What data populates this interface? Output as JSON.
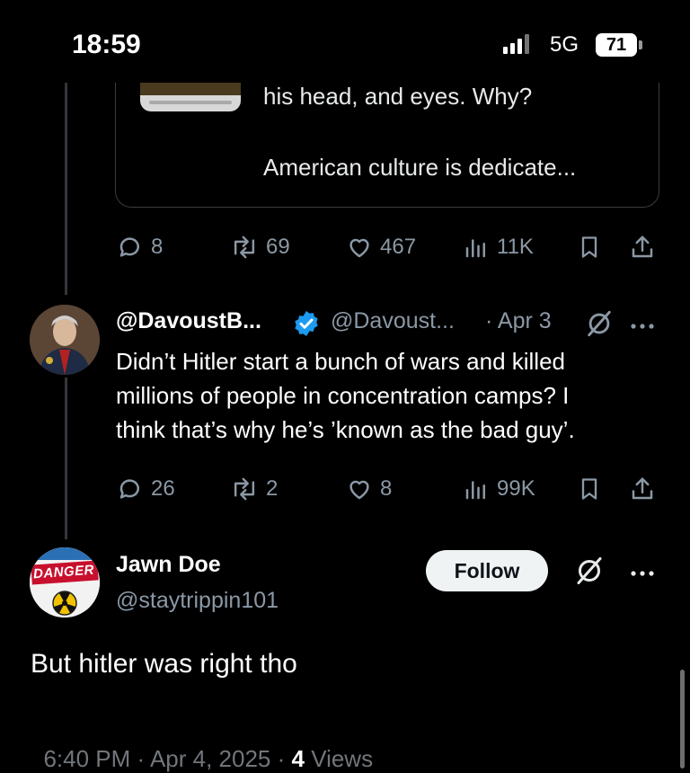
{
  "status_bar": {
    "time": "18:59",
    "network": "5G",
    "battery": "71"
  },
  "quoted_tweet": {
    "line1": "his head, and eyes.  Why?",
    "line2": "American culture is dedicate..."
  },
  "tweet1_actions": {
    "replies": "8",
    "reposts": "69",
    "likes": "467",
    "views": "11K"
  },
  "reply_tweet": {
    "display_name": "@DavoustB...",
    "handle": "@Davoust...",
    "date": "· Apr 3",
    "lines": [
      "Didn’t Hitler start a bunch of wars and killed",
      "millions of people in concentration camps? I",
      "think that’s why he’s ’known as the bad guy’."
    ],
    "actions": {
      "replies": "26",
      "reposts": "2",
      "likes": "8",
      "views": "99K"
    }
  },
  "main_tweet": {
    "display_name": "Jawn Doe",
    "handle": "@staytrippin101",
    "avatar_text": "DANGER",
    "follow_label": "Follow",
    "text": "But hitler was right tho",
    "time": "6:40 PM · Apr 4, 2025 · ",
    "views_count": "4",
    "views_label": " Views"
  },
  "colors": {
    "background": "#000000",
    "secondary_text": "#8b98a5",
    "verified": "#1d9bf0",
    "danger_red": "#c8102e"
  },
  "icons": [
    "reply-icon",
    "repost-icon",
    "like-icon",
    "views-icon",
    "bookmark-icon",
    "share-icon",
    "grok-icon",
    "more-icon",
    "verified-badge-icon"
  ]
}
